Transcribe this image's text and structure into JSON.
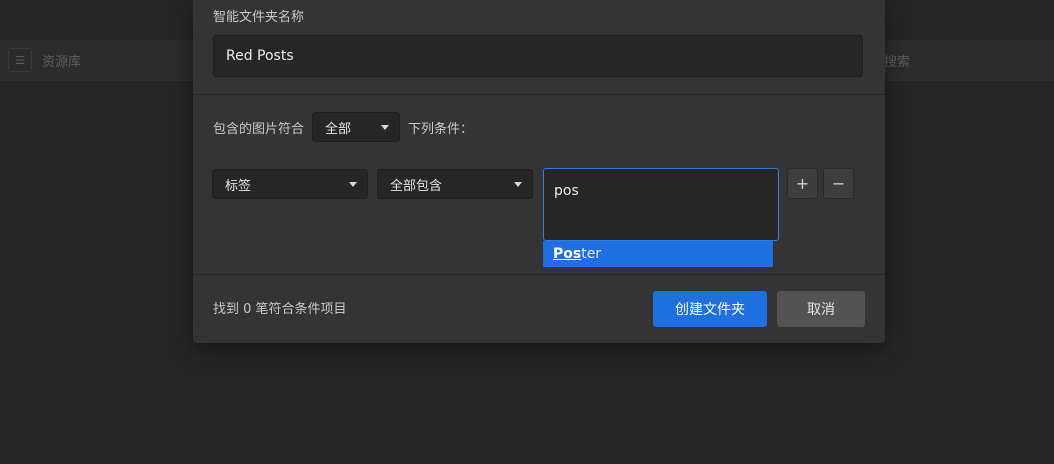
{
  "background": {
    "library_label": "资源库",
    "search_label": "搜索"
  },
  "dialog": {
    "name_label": "智能文件夹名称",
    "name_value": "Red Posts",
    "rule_prefix": "包含的图片符合",
    "match_mode": "全部",
    "rule_suffix": "下列条件：",
    "condition": {
      "field": "标签",
      "operator": "全部包含",
      "value": "pos",
      "suggestion_match": "Pos",
      "suggestion_rest": "ter"
    },
    "add_symbol": "+",
    "remove_symbol": "−",
    "result_text": "找到 0 笔符合条件项目",
    "create_label": "创建文件夹",
    "cancel_label": "取消"
  },
  "colors": {
    "accent": "#1e6fe0",
    "dialog_bg": "#343434",
    "app_bg": "#262626"
  }
}
